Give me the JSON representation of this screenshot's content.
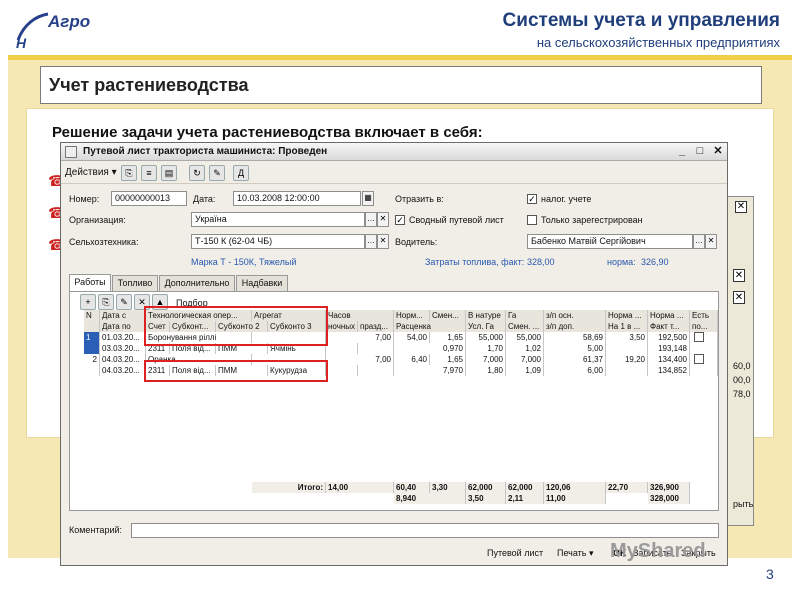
{
  "logo": {
    "text": "Агро"
  },
  "header": {
    "title": "Системы учета и управления",
    "subtitle": "на сельскохозяйственных предприятиях"
  },
  "slide": {
    "title": "Учет растениеводства",
    "subhead": "Решение задачи учета растениеводства включает в себя:",
    "page_number": "3",
    "watermark": "MyShared"
  },
  "window": {
    "title": "Путевой лист тракториста машиниста: Проведен",
    "actions_label": "Действия",
    "fields": {
      "number_label": "Номер:",
      "number": "00000000013",
      "date_label": "Дата:",
      "date": "10.03.2008 12:00:00",
      "reflect_label": "Отразить в:",
      "tax_label": "налог. учете",
      "org_label": "Организация:",
      "org": "Україна",
      "summary_label": "Сводный путевой лист",
      "registered_label": "Только зарегестрирован",
      "machine_label": "Сельхозтехника:",
      "machine": "Т-150 К (62-04 ЧБ)",
      "driver_label": "Водитель:",
      "driver": "Бабенко Матвій Сергійович",
      "brand": "Марка Т - 150К, Тяжелый",
      "fuel_label": "Затраты топлива, факт:",
      "fuel": "328,00",
      "norm_label": "норма:",
      "norm": "326,90"
    },
    "tabs": [
      "Работы",
      "Топливо",
      "Дополнительно",
      "Надбавки"
    ],
    "podbor_label": "Подбор",
    "grid_header1": [
      "N",
      "Дата с",
      "Технологическая опер...",
      "Агрегат",
      "Часов",
      "Норм...",
      "Смен...",
      "В натуре",
      "Га",
      "з/п осн.",
      "Норма ...",
      "Норма ...",
      "Есть"
    ],
    "grid_header2": [
      "",
      "Дата по",
      "Счет",
      "Субконт...",
      "Субконто 2",
      "Субконто 3",
      "ночных",
      "празд...",
      "Расценка",
      "",
      "Усл. Га",
      "Смен. ...",
      "з/п доп.",
      "На 1 в ...",
      "Факт т...",
      "по..."
    ],
    "rows": [
      {
        "n": "1",
        "date_from": "01.03.20...",
        "oper": "Боронування ріллі",
        "hours": "7,00",
        "norm": "54,00",
        "smen": "1,65",
        "natura": "55,000",
        "ga": "55,000",
        "zp": "58,69",
        "norma1": "3,50",
        "norma2": "192,500"
      },
      {
        "n": "",
        "date_from": "03.03.20...",
        "schet": "2311",
        "sub1": "Поля від...",
        "sub2": "ПММ",
        "sub3": "Ячмінь",
        "rascenka": "0,970",
        "usl": "1,70",
        "smen2": "1,02",
        "zpdop": "5,00",
        "fact": "193,148"
      },
      {
        "n": "2",
        "date_from": "04.03.20...",
        "oper": "Оранка",
        "hours": "7,00",
        "norm": "6,40",
        "smen": "1,65",
        "natura": "7,000",
        "ga": "7,000",
        "zp": "61,37",
        "norma1": "19,20",
        "norma2": "134,400"
      },
      {
        "n": "",
        "date_from": "04.03.20...",
        "schet": "2311",
        "sub1": "Поля від...",
        "sub2": "ПММ",
        "sub3": "Кукурудза",
        "rascenka": "7,970",
        "usl": "1,80",
        "smen2": "1,09",
        "zpdop": "6,00",
        "fact": "134,852"
      }
    ],
    "totals1": {
      "label": "Итого:",
      "hours": "14,00",
      "norm": "60,40",
      "smen": "3,30",
      "natura": "62,000",
      "ga": "62,000",
      "zp": "120,06",
      "norma1": "22,70",
      "norma2": "326,900"
    },
    "totals2": {
      "rascenka": "8,940",
      "usl": "3,50",
      "smen2": "2,11",
      "zpdop": "11,00",
      "fact": "328,000"
    },
    "comment_label": "Коментарий:",
    "footer": {
      "putevoy": "Путевой лист",
      "pechat": "Печать",
      "ok": "OK",
      "zapisat": "Записать",
      "zakryt": "Закрыть"
    }
  },
  "back_window": {
    "values": [
      "60,0",
      "00,0",
      "78,0"
    ],
    "button": "рыть"
  }
}
